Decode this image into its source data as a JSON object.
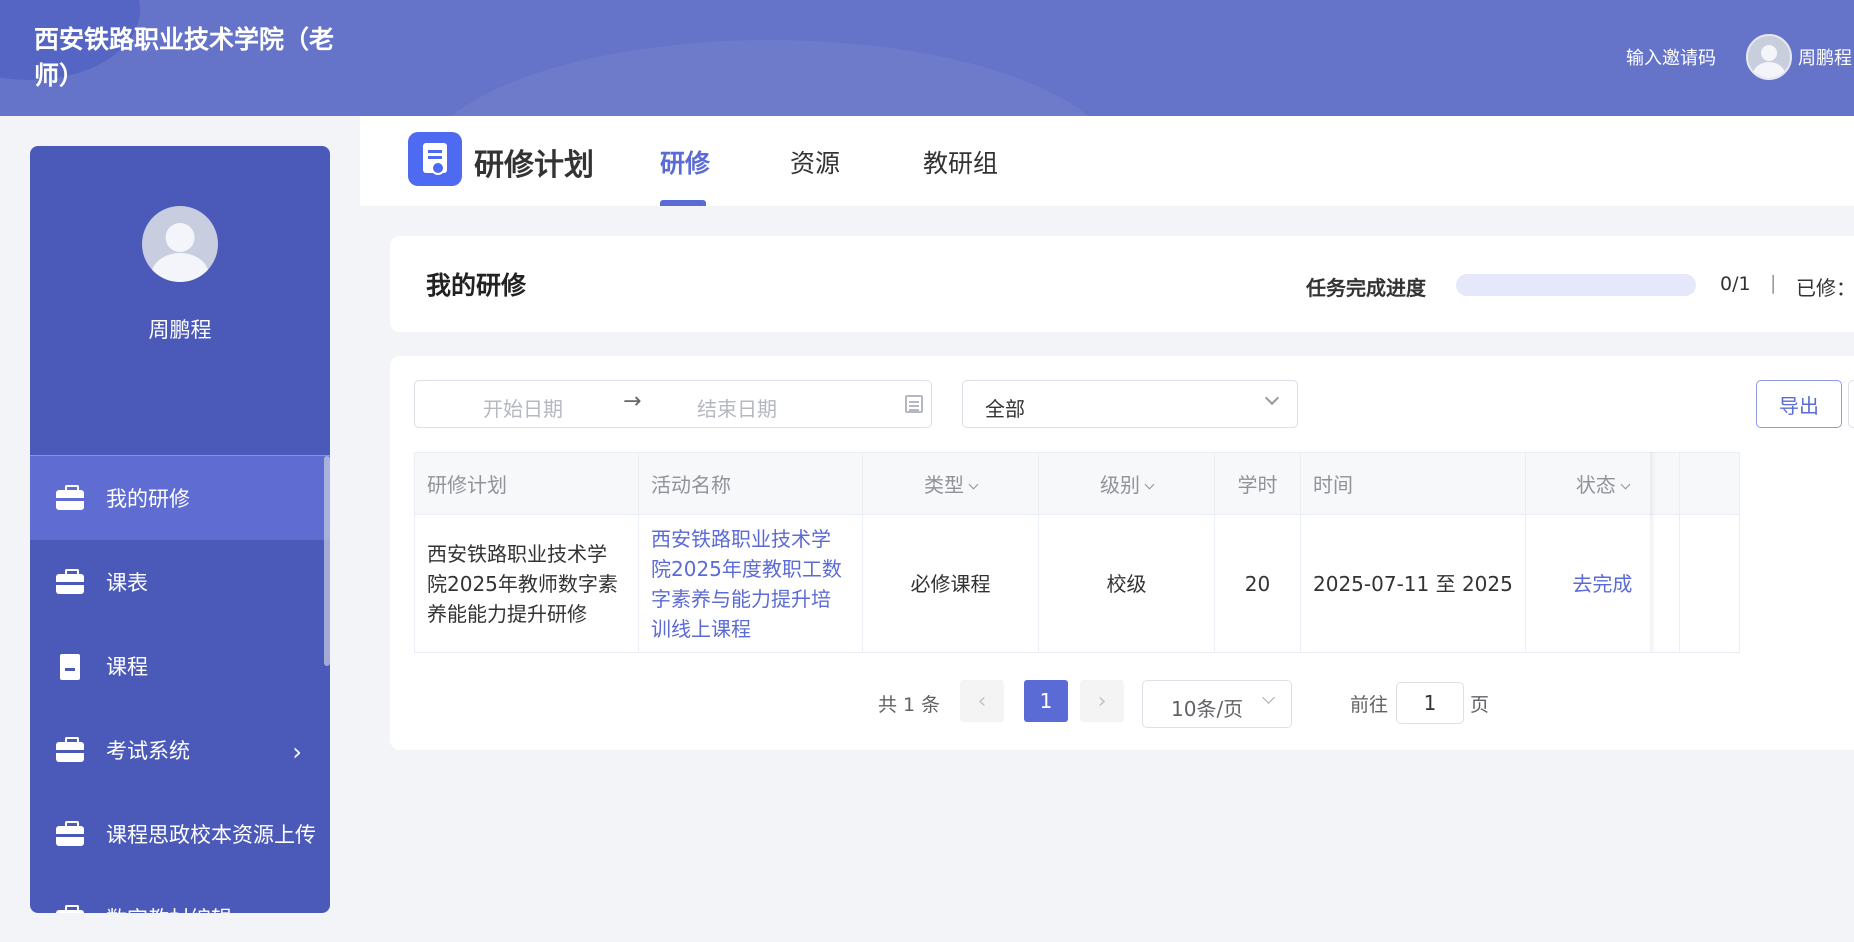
{
  "header": {
    "title": "西安铁路职业技术学院（老师）",
    "invite_label": "输入邀请码",
    "username": "周鹏程"
  },
  "sidebar": {
    "profile_name": "周鹏程",
    "items": [
      {
        "label": "我的研修",
        "icon": "briefcase-icon",
        "active": true
      },
      {
        "label": "课表",
        "icon": "briefcase-icon"
      },
      {
        "label": "课程",
        "icon": "bookmark-icon"
      },
      {
        "label": "考试系统",
        "icon": "briefcase-icon",
        "has_submenu": true
      },
      {
        "label": "课程思政校本资源上传",
        "icon": "briefcase-icon"
      },
      {
        "label": "数字教材编辑",
        "icon": "briefcase-icon"
      }
    ]
  },
  "tabbar": {
    "page_title": "研修计划",
    "tabs": [
      {
        "label": "研修",
        "active": true
      },
      {
        "label": "资源"
      },
      {
        "label": "教研组"
      }
    ]
  },
  "summary": {
    "title": "我的研修",
    "progress_label": "任务完成进度",
    "progress_fraction": 0,
    "progress_value": "0/1",
    "separator": "|",
    "studied_label": "已修："
  },
  "filters": {
    "start_placeholder": "开始日期",
    "end_placeholder": "结束日期",
    "range_separator": "→",
    "type_select_value": "全部",
    "export_label": "导出"
  },
  "table": {
    "columns": [
      "研修计划",
      "活动名称",
      "类型",
      "级别",
      "学时",
      "时间",
      "状态"
    ],
    "rows": [
      {
        "plan": "西安铁路职业技术学院2025年教师数字素养能能力提升研修",
        "activity": "西安铁路职业技术学院2025年度教职工数字素养与能力提升培训线上课程",
        "type": "必修课程",
        "level": "校级",
        "hours": "20",
        "time": "2025-07-11 至 2025",
        "status": "去完成"
      }
    ]
  },
  "pagination": {
    "total_label": "共 1 条",
    "prev": "‹",
    "current_page": "1",
    "next": "›",
    "page_size": "10条/页",
    "goto_label": "前往",
    "goto_value": "1",
    "page_suffix": "页"
  },
  "colors": {
    "header_bg": "#6573c8",
    "sidebar_bg": "#4b59b9",
    "sidebar_active": "#5f6cd1",
    "accent": "#5b6bd6"
  }
}
